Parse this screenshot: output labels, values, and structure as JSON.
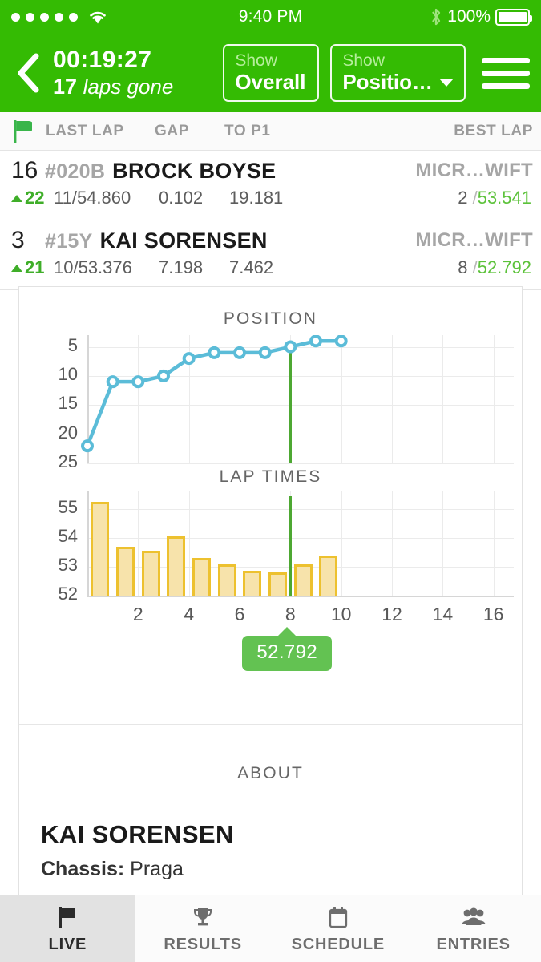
{
  "status_bar": {
    "signal_dots": 5,
    "wifi_icon": "wifi-icon",
    "time": "9:40 PM",
    "bluetooth_icon": "bluetooth-icon",
    "battery_percent": "100%",
    "battery_icon": "battery-full-icon"
  },
  "nav": {
    "back_icon": "back-chevron-icon",
    "clock": "00:19:27",
    "laps_count": "17",
    "laps_label": "laps gone",
    "buttons": [
      {
        "label": "Show",
        "value": "Overall",
        "has_caret": false,
        "name": "show-overall-button"
      },
      {
        "label": "Show",
        "value": "Positio…",
        "has_caret": true,
        "name": "show-position-button"
      }
    ],
    "menu_icon": "hamburger-menu-icon"
  },
  "columns": {
    "flag_icon": "green-flag-icon",
    "last_lap": "LAST LAP",
    "gap": "GAP",
    "to_p1": "TO P1",
    "best_lap": "BEST LAP"
  },
  "rows": [
    {
      "position": "16",
      "car_number": "#020B",
      "driver": "BROCK BOYSE",
      "team": "MICR…WIFT",
      "delta": "22",
      "delta_direction": "up",
      "last_lap": "11/54.860",
      "gap": "0.102",
      "to_p1": "19.181",
      "best_lap_number": "2",
      "best_lap_time": "53.541"
    },
    {
      "position": "3",
      "car_number": "#15Y",
      "driver": "KAI SORENSEN",
      "team": "MICR…WIFT",
      "delta": "21",
      "delta_direction": "up",
      "last_lap": "10/53.376",
      "gap": "7.198",
      "to_p1": "7.462",
      "best_lap_number": "8",
      "best_lap_time": "52.792"
    }
  ],
  "about": {
    "section_title": "ABOUT",
    "driver_name": "KAI SORENSEN",
    "chassis_label": "Chassis:",
    "chassis_value": "Praga"
  },
  "tabs": [
    {
      "label": "LIVE",
      "icon": "flag-icon",
      "active": true
    },
    {
      "label": "RESULTS",
      "icon": "trophy-icon",
      "active": false
    },
    {
      "label": "SCHEDULE",
      "icon": "calendar-icon",
      "active": false
    },
    {
      "label": "ENTRIES",
      "icon": "people-icon",
      "active": false
    }
  ],
  "colors": {
    "brand_green": "#34bb03",
    "marker_green": "#4da832",
    "tooltip_green": "#63c252",
    "position_line": "#5bbcd8",
    "bar_fill": "#f7e3ab",
    "bar_stroke": "#edc12f",
    "best_lap_green": "#5cc23a"
  },
  "chart_data": [
    {
      "type": "line",
      "title": "POSITION",
      "name": "position-chart",
      "xlabel": "",
      "ylabel": "",
      "x": [
        0,
        1,
        2,
        3,
        4,
        5,
        6,
        7,
        8,
        9,
        10
      ],
      "values": [
        22,
        11,
        11,
        10,
        7,
        6,
        6,
        6,
        5,
        4,
        4
      ],
      "ylim": [
        25,
        3
      ],
      "y_ticks": [
        5,
        10,
        15,
        20,
        25
      ],
      "y_inverted": true,
      "x_ticks": [
        0,
        2,
        4,
        6,
        8,
        10,
        12,
        14,
        16
      ],
      "xlim": [
        0,
        16.8
      ],
      "grid": true,
      "marker_lap": 8,
      "line_color": "#5bbcd8",
      "point_style": "open-circle"
    },
    {
      "type": "bar",
      "title": "LAP TIMES",
      "name": "lap-times-chart",
      "xlabel": "",
      "ylabel": "",
      "categories": [
        1,
        2,
        3,
        4,
        5,
        6,
        7,
        8,
        9,
        10
      ],
      "values": [
        55.25,
        53.68,
        53.55,
        54.04,
        53.3,
        53.08,
        52.87,
        52.79,
        53.08,
        53.38
      ],
      "ylim": [
        52,
        55.6
      ],
      "y_ticks": [
        52,
        53,
        54,
        55
      ],
      "x_ticks": [
        2,
        4,
        6,
        8,
        10,
        12,
        14,
        16
      ],
      "xlim": [
        0,
        16.8
      ],
      "grid": true,
      "marker_lap": 8,
      "highlight_label": "52.792",
      "bar_fill": "#f7e3ab",
      "bar_stroke": "#edc12f"
    }
  ]
}
